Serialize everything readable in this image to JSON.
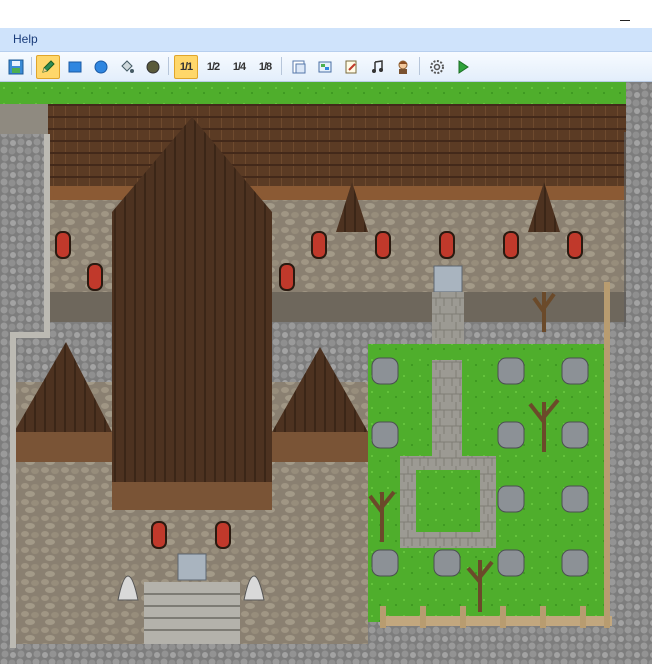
{
  "window": {
    "minimize_glyph": "–"
  },
  "menu": {
    "items": [
      {
        "label": "Help"
      }
    ]
  },
  "toolbar": {
    "buttons": [
      {
        "icon": "save-project-icon"
      },
      {
        "icon": "pencil-icon",
        "active": true
      },
      {
        "icon": "rectangle-icon"
      },
      {
        "icon": "ellipse-icon"
      },
      {
        "icon": "fill-icon"
      },
      {
        "icon": "shadow-pen-icon"
      },
      {
        "icon": "zoom-1-1-icon",
        "label": "1/1",
        "active": true
      },
      {
        "icon": "zoom-1-2-icon",
        "label": "1/2"
      },
      {
        "icon": "zoom-1-4-icon",
        "label": "1/4"
      },
      {
        "icon": "zoom-1-8-icon",
        "label": "1/8"
      },
      {
        "icon": "database-icon"
      },
      {
        "icon": "resource-manager-icon"
      },
      {
        "icon": "script-editor-icon"
      },
      {
        "icon": "sound-test-icon"
      },
      {
        "icon": "character-generator-icon"
      },
      {
        "icon": "options-icon"
      },
      {
        "icon": "playtest-icon"
      }
    ]
  },
  "map": {
    "description_colors": {
      "roof": "#5b3b24",
      "wall": "#8a8071",
      "grass": "#4fae2c",
      "cobble": "#7d7d7d",
      "stone_floor": "#9c9a93"
    }
  }
}
